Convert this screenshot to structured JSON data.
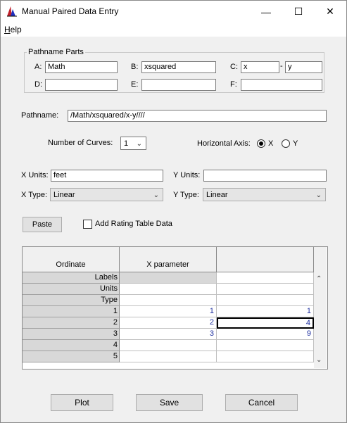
{
  "window": {
    "title": "Manual Paired Data Entry",
    "minimize": "—",
    "maximize": "☐",
    "close": "✕"
  },
  "menu": {
    "help": "Help"
  },
  "pathname_parts": {
    "group_label": "Pathname Parts",
    "a_label": "A:",
    "a_value": "Math",
    "b_label": "B:",
    "b_value": "xsquared",
    "c_label": "C:",
    "c_value1": "x",
    "c_sep": "-",
    "c_value2": "y",
    "d_label": "D:",
    "d_value": "",
    "e_label": "E:",
    "e_value": "",
    "f_label": "F:",
    "f_value": ""
  },
  "pathname": {
    "label": "Pathname:",
    "value": "/Math/xsquared/x-y////"
  },
  "curves": {
    "label": "Number of Curves:",
    "value": "1"
  },
  "horizontal_axis": {
    "label": "Horizontal Axis:",
    "x_label": "X",
    "y_label": "Y",
    "selected": "X"
  },
  "x_units": {
    "label": "X Units:",
    "value": "feet"
  },
  "y_units": {
    "label": "Y Units:",
    "value": ""
  },
  "x_type": {
    "label": "X Type:",
    "value": "Linear"
  },
  "y_type": {
    "label": "Y Type:",
    "value": "Linear"
  },
  "paste_button": "Paste",
  "rating_checkbox": {
    "label": "Add Rating Table Data",
    "checked": false
  },
  "table": {
    "headers": [
      "Ordinate",
      "X parameter",
      ""
    ],
    "rows": [
      {
        "label": "Labels",
        "x": "",
        "y": ""
      },
      {
        "label": "Units",
        "x": "",
        "y": ""
      },
      {
        "label": "Type",
        "x": "",
        "y": ""
      },
      {
        "label": "1",
        "x": "1",
        "y": "1"
      },
      {
        "label": "2",
        "x": "2",
        "y": "4"
      },
      {
        "label": "3",
        "x": "3",
        "y": "9"
      },
      {
        "label": "4",
        "x": "",
        "y": ""
      },
      {
        "label": "5",
        "x": "",
        "y": ""
      }
    ]
  },
  "buttons": {
    "plot": "Plot",
    "save": "Save",
    "cancel": "Cancel"
  }
}
